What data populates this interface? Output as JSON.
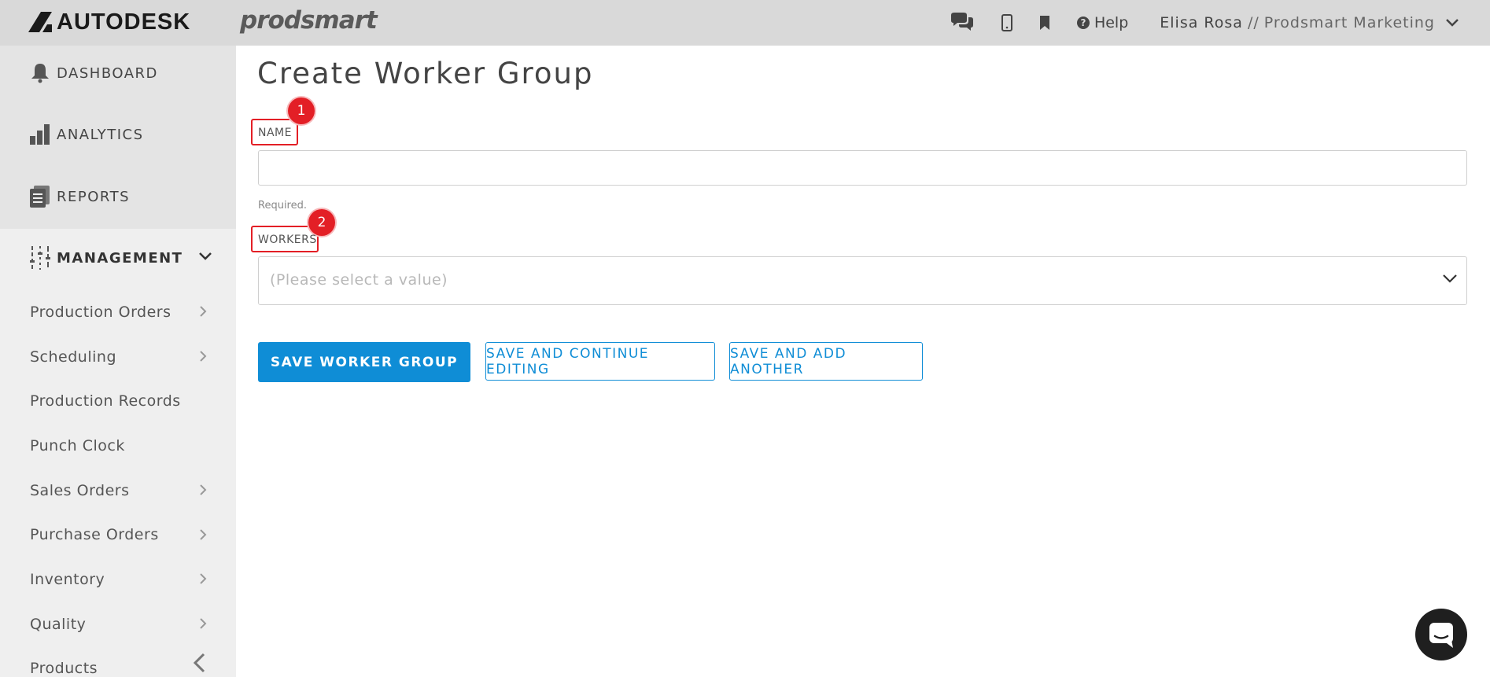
{
  "header": {
    "brand": "AUTODESK",
    "product": "prodsmart",
    "help_label": "Help",
    "user_name": "Elisa Rosa",
    "user_separator": "//",
    "org_name": "Prodsmart Marketing",
    "icons": [
      "chat-icon",
      "mobile-icon",
      "bookmark-icon",
      "help-icon",
      "chevron-down-icon"
    ]
  },
  "sidebar": {
    "main_items": [
      {
        "label": "DASHBOARD",
        "icon": "bell-icon"
      },
      {
        "label": "ANALYTICS",
        "icon": "bar-chart-icon"
      },
      {
        "label": "REPORTS",
        "icon": "document-icon"
      },
      {
        "label": "MANAGEMENT",
        "icon": "sliders-icon"
      }
    ],
    "sub_items": [
      {
        "label": "Production Orders",
        "chevron": true
      },
      {
        "label": "Scheduling",
        "chevron": true
      },
      {
        "label": "Production Records",
        "chevron": false
      },
      {
        "label": "Punch Clock",
        "chevron": false
      },
      {
        "label": "Sales Orders",
        "chevron": true
      },
      {
        "label": "Purchase Orders",
        "chevron": true
      },
      {
        "label": "Inventory",
        "chevron": true
      },
      {
        "label": "Quality",
        "chevron": true
      },
      {
        "label": "Products",
        "chevron": false
      }
    ]
  },
  "main": {
    "title": "Create Worker Group",
    "name_field": {
      "label": "NAME",
      "value": "",
      "help": "Required."
    },
    "workers_field": {
      "label": "WORKERS",
      "placeholder": "(Please select a value)"
    },
    "annotations": [
      "1",
      "2"
    ],
    "buttons": {
      "save": "SAVE WORKER GROUP",
      "save_continue": "SAVE AND CONTINUE EDITING",
      "save_add": "SAVE AND ADD ANOTHER"
    }
  },
  "colors": {
    "accent": "#0f8dd6",
    "annotation": "#e31f26",
    "topbar": "#d9d9d9",
    "sidebar": "#efefef"
  }
}
